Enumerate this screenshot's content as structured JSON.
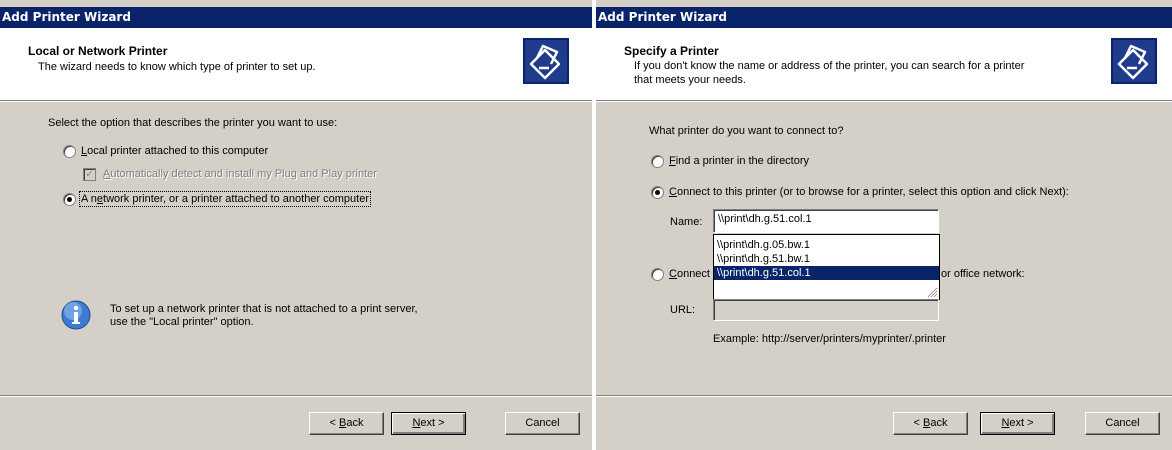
{
  "left": {
    "title": "Add Printer Wizard",
    "header": {
      "title": "Local or Network Printer",
      "subtitle": "The wizard needs to know which type of printer to set up."
    },
    "prompt": "Select the option that describes the printer you want to use:",
    "options": {
      "local": {
        "pre": "",
        "accel": "L",
        "post": "ocal printer attached to this computer",
        "checked": false
      },
      "autodetect": {
        "pre": "",
        "accel": "A",
        "post": "utomatically detect and install my Plug and Play printer",
        "checked": true,
        "enabled": false
      },
      "network": {
        "pre": "A n",
        "accel": "e",
        "post": "twork printer, or a printer attached to another computer",
        "checked": true
      }
    },
    "info": {
      "line1": "To set up a network printer that is not attached to a print server,",
      "line2": "use the \"Local printer\" option."
    },
    "buttons": {
      "back_pre": "< ",
      "back_accel": "B",
      "back_post": "ack",
      "next_pre": "",
      "next_accel": "N",
      "next_post": "ext >",
      "cancel": "Cancel"
    }
  },
  "right": {
    "title": "Add Printer Wizard",
    "header": {
      "title": "Specify a Printer",
      "subtitle_line1": "If you don't know the name or address of the printer, you can search for a printer",
      "subtitle_line2": "that meets your needs."
    },
    "prompt": "What printer do you want to connect to?",
    "options": {
      "find": {
        "accel": "F",
        "post": "ind a printer in the directory",
        "checked": false
      },
      "connect": {
        "accel": "C",
        "post": "onnect to this printer (or to browse for a printer, select this option and click Next):",
        "checked": true
      },
      "url_option": {
        "accel": "C",
        "post": "onnect",
        "tail": "or office network:",
        "checked": false
      }
    },
    "name_label": "Name:",
    "name_value": "\\\\print\\dh.g.51.col.1",
    "autocomplete": [
      "\\\\print\\dh.g.05.bw.1",
      "\\\\print\\dh.g.51.bw.1",
      "\\\\print\\dh.g.51.col.1"
    ],
    "selected_index": 2,
    "url_label": "URL:",
    "url_value": "",
    "example": "Example: http://server/printers/myprinter/.printer",
    "buttons": {
      "back_pre": "< ",
      "back_accel": "B",
      "back_post": "ack",
      "next_pre": "",
      "next_accel": "N",
      "next_post": "ext >",
      "cancel": "Cancel"
    }
  },
  "colors": {
    "titlebar": "#0a246a",
    "face": "#d4d0c8",
    "selection": "#0a246a"
  },
  "icons": {
    "header": "printer-wizard-icon",
    "info": "info-icon",
    "grip": "resize-grip-icon"
  }
}
